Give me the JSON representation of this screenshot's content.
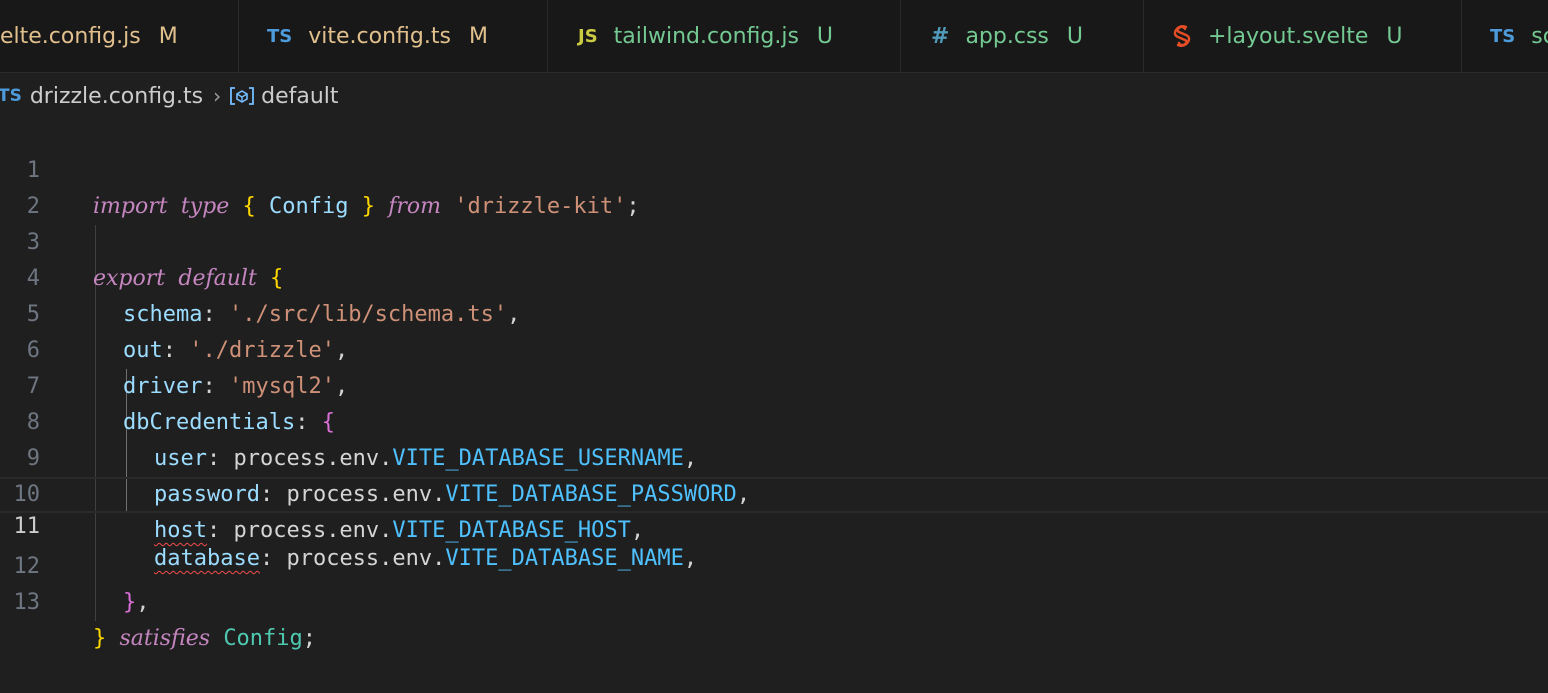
{
  "tabs": [
    {
      "icon": "",
      "name": "elte.config.js",
      "status": "M",
      "name_color": "#e2c08d",
      "status_color": "#e2c08d",
      "icon_color": "#cbcb41"
    },
    {
      "icon": "TS",
      "name": "vite.config.ts",
      "status": "M",
      "name_color": "#e2c08d",
      "status_color": "#e2c08d",
      "icon_color": "#4d9bdb"
    },
    {
      "icon": "JS",
      "name": "tailwind.config.js",
      "status": "U",
      "name_color": "#73c991",
      "status_color": "#73c991",
      "icon_color": "#cbcb41"
    },
    {
      "icon": "#",
      "name": "app.css",
      "status": "U",
      "name_color": "#73c991",
      "status_color": "#73c991",
      "icon_color": "#519aba"
    },
    {
      "icon": "S",
      "name": "+layout.svelte",
      "status": "U",
      "name_color": "#73c991",
      "status_color": "#73c991",
      "icon_color": "#e44d26"
    },
    {
      "icon": "TS",
      "name": "sc",
      "status": "",
      "name_color": "#73c991",
      "status_color": "#73c991",
      "icon_color": "#4d9bdb"
    }
  ],
  "breadcrumb": {
    "file_icon": "TS",
    "file": "drizzle.config.ts",
    "symbol": "default"
  },
  "editor": {
    "active_line": 11,
    "lines": [
      {
        "n": "1"
      },
      {
        "n": "2"
      },
      {
        "n": "3"
      },
      {
        "n": "4"
      },
      {
        "n": "5"
      },
      {
        "n": "6"
      },
      {
        "n": "7"
      },
      {
        "n": "8"
      },
      {
        "n": "9"
      },
      {
        "n": "10"
      },
      {
        "n": "11"
      },
      {
        "n": "12"
      },
      {
        "n": "13"
      }
    ],
    "tokens": {
      "l1_import": "import",
      "l1_type": "type",
      "l1_ob": "{",
      "l1_config": " Config ",
      "l1_cb": "}",
      "l1_from": "from",
      "l1_str": "'drizzle-kit'",
      "l1_semi": ";",
      "l3_export": "export",
      "l3_default": "default",
      "l3_ob": "{",
      "l4_key": "schema",
      "l4_colon": ": ",
      "l4_str": "'./src/lib/schema.ts'",
      "l4_comma": ",",
      "l5_key": "out",
      "l5_colon": ": ",
      "l5_str": "'./drizzle'",
      "l5_comma": ",",
      "l6_key": "driver",
      "l6_colon": ": ",
      "l6_str": "'mysql2'",
      "l6_comma": ",",
      "l7_key": "dbCredentials",
      "l7_colon": ": ",
      "l7_ob": "{",
      "l8_key": "user",
      "l8_mid": ": process.env.",
      "l8_const": "VITE_DATABASE_USERNAME",
      "l8_comma": ",",
      "l9_key": "password",
      "l9_mid": ": process.env.",
      "l9_const": "VITE_DATABASE_PASSWORD",
      "l9_comma": ",",
      "l10_key": "host",
      "l10_mid": ": process.env.",
      "l10_const": "VITE_DATABASE_HOST",
      "l10_comma": ",",
      "l11_key": "database",
      "l11_mid": ": process.env.",
      "l11_const": "VITE_DATABASE_NAME",
      "l11_comma": ",",
      "l12_cb": "}",
      "l12_comma": ",",
      "l13_cb": "}",
      "l13_satisfies": "satisfies",
      "l13_config": "Config",
      "l13_semi": ";"
    }
  },
  "colors": {
    "background": "#1f1f1f",
    "tabbar": "#181818",
    "modified": "#e2c08d",
    "untracked": "#73c991",
    "error_squiggle": "#f14c4c"
  }
}
